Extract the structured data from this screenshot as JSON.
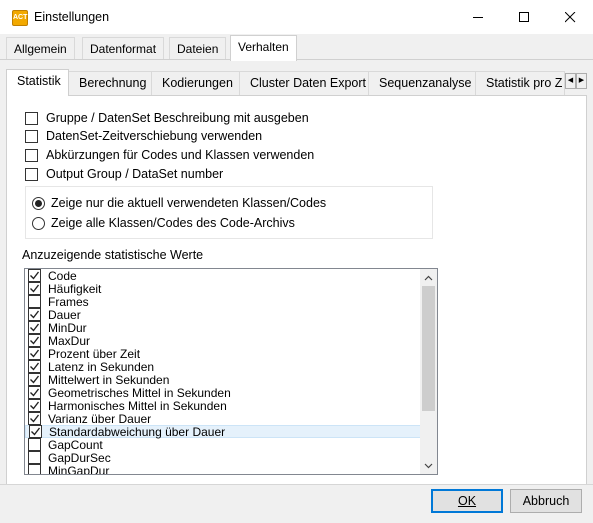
{
  "window": {
    "title": "Einstellungen"
  },
  "outer_tabs": [
    "Allgemein",
    "Datenformat",
    "Dateien",
    "Verhalten"
  ],
  "inner_tabs": [
    "Statistik",
    "Berechnung",
    "Kodierungen",
    "Cluster Daten Export",
    "Sequenzanalyse",
    "Statistik pro Z"
  ],
  "options": [
    {
      "label": "Gruppe / DatenSet Beschreibung mit ausgeben",
      "checked": false
    },
    {
      "label": "DatenSet-Zeitverschiebung verwenden",
      "checked": false
    },
    {
      "label": "Abkürzungen für Codes und Klassen verwenden",
      "checked": false
    },
    {
      "label": "Output Group / DataSet number",
      "checked": false
    }
  ],
  "radios": [
    {
      "label": "Zeige nur die aktuell verwendeten Klassen/Codes",
      "selected": true
    },
    {
      "label": "Zeige alle Klassen/Codes des Code-Archivs",
      "selected": false
    }
  ],
  "stats_list": {
    "label": "Anzuzeigende statistische Werte",
    "items": [
      {
        "label": "Code",
        "checked": true
      },
      {
        "label": "Häufigkeit",
        "checked": true
      },
      {
        "label": "Frames",
        "checked": false
      },
      {
        "label": "Dauer",
        "checked": true
      },
      {
        "label": "MinDur",
        "checked": true
      },
      {
        "label": "MaxDur",
        "checked": true
      },
      {
        "label": "Prozent über Zeit",
        "checked": true
      },
      {
        "label": "Latenz in Sekunden",
        "checked": true
      },
      {
        "label": "Mittelwert in Sekunden",
        "checked": true
      },
      {
        "label": "Geometrisches Mittel in Sekunden",
        "checked": true
      },
      {
        "label": "Harmonisches Mittel in Sekunden",
        "checked": true
      },
      {
        "label": "Varianz über Dauer",
        "checked": true
      },
      {
        "label": "Standardabweichung über Dauer",
        "checked": true,
        "selected": true
      },
      {
        "label": "GapCount",
        "checked": false
      },
      {
        "label": "GapDurSec",
        "checked": false
      },
      {
        "label": "MinGapDur",
        "checked": false
      }
    ]
  },
  "buttons": {
    "ok": "OK",
    "cancel": "Abbruch"
  }
}
